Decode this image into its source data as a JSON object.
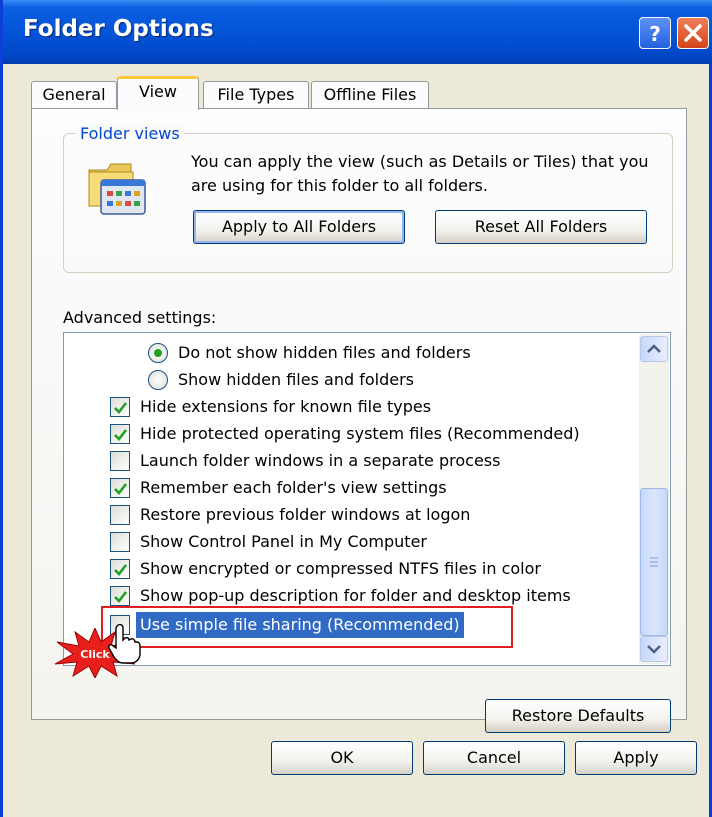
{
  "window": {
    "title": "Folder Options"
  },
  "tabs": [
    {
      "label": "General",
      "active": false
    },
    {
      "label": "View",
      "active": true
    },
    {
      "label": "File Types",
      "active": false
    },
    {
      "label": "Offline Files",
      "active": false
    }
  ],
  "folder_views": {
    "legend": "Folder views",
    "description": "You can apply the view (such as Details or Tiles) that you are using for this folder to all folders.",
    "apply_label": "Apply to All Folders",
    "reset_label": "Reset All Folders"
  },
  "advanced": {
    "label": "Advanced settings:",
    "items": [
      {
        "type": "radio",
        "checked": true,
        "label": "Do not show hidden files and folders"
      },
      {
        "type": "radio",
        "checked": false,
        "label": "Show hidden files and folders"
      },
      {
        "type": "checkbox",
        "checked": true,
        "label": "Hide extensions for known file types"
      },
      {
        "type": "checkbox",
        "checked": true,
        "label": "Hide protected operating system files (Recommended)"
      },
      {
        "type": "checkbox",
        "checked": false,
        "label": "Launch folder windows in a separate process"
      },
      {
        "type": "checkbox",
        "checked": true,
        "label": "Remember each folder's view settings"
      },
      {
        "type": "checkbox",
        "checked": false,
        "label": "Restore previous folder windows at logon"
      },
      {
        "type": "checkbox",
        "checked": false,
        "label": "Show Control Panel in My Computer"
      },
      {
        "type": "checkbox",
        "checked": true,
        "label": "Show encrypted or compressed NTFS files in color"
      },
      {
        "type": "checkbox",
        "checked": true,
        "label": "Show pop-up description for folder and desktop items"
      },
      {
        "type": "checkbox",
        "checked": false,
        "label": "Use simple file sharing (Recommended)",
        "selected": true
      }
    ],
    "restore_label": "Restore Defaults"
  },
  "footer": {
    "ok_label": "OK",
    "cancel_label": "Cancel",
    "apply_label": "Apply"
  },
  "annotation": {
    "text": "Click"
  },
  "colors": {
    "title_bar": "#0454d8",
    "selection": "#316ac5",
    "highlight_box": "#e02020",
    "check": "#21a121"
  }
}
